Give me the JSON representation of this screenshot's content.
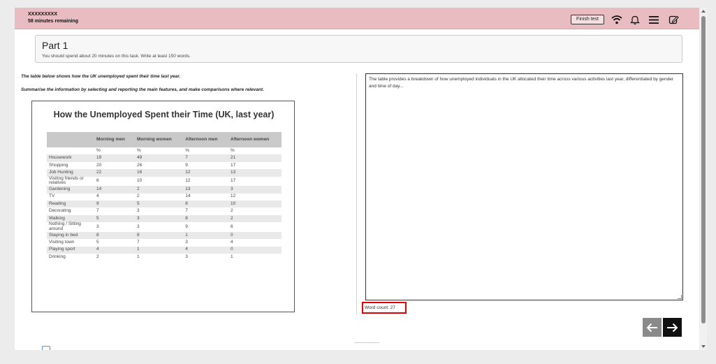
{
  "header": {
    "candidate_id": "XXXXXXXXX",
    "time_remaining": "58 minutes remaining",
    "finish_label": "Finish test",
    "icons": [
      "wifi-icon",
      "bell-icon",
      "menu-icon",
      "edit-note-icon"
    ]
  },
  "part": {
    "title": "Part 1",
    "instructions": "You should spend about 20 minutes on this task. Write at least 150 words."
  },
  "prompt": {
    "line1": "The table below shows how the UK unemployed spent their time last year.",
    "line2": "Summarise the information by selecting and reporting the main features, and make comparisons where relevant."
  },
  "figure": {
    "title": "How the Unemployed Spent their Time (UK, last year)",
    "columns": [
      "",
      "Morning men",
      "Morning women",
      "Afternoon men",
      "Afternoon women"
    ],
    "unit_row": [
      "",
      "%",
      "%",
      "%",
      "%"
    ],
    "rows": [
      [
        "Housework",
        "19",
        "49",
        "7",
        "21"
      ],
      [
        "Shopping",
        "20",
        "26",
        "9",
        "17"
      ],
      [
        "Job Hunting",
        "22",
        "16",
        "12",
        "13"
      ],
      [
        "Visiting friends or relatives",
        "6",
        "10",
        "12",
        "17"
      ],
      [
        "Gardening",
        "14",
        "2",
        "13",
        "3"
      ],
      [
        "TV",
        "4",
        "2",
        "14",
        "12"
      ],
      [
        "Reading",
        "9",
        "5",
        "8",
        "10"
      ],
      [
        "Decorating",
        "7",
        "3",
        "7",
        "2"
      ],
      [
        "Walking",
        "5",
        "3",
        "8",
        "2"
      ],
      [
        "Nothing / Sitting around",
        "3",
        "3",
        "9",
        "6"
      ],
      [
        "Staying in bed",
        "8",
        "8",
        "1",
        "0"
      ],
      [
        "Visiting town",
        "5",
        "7",
        "3",
        "4"
      ],
      [
        "Playing sport",
        "4",
        "1",
        "4",
        "0"
      ],
      [
        "Drinking",
        "2",
        "1",
        "3",
        "1"
      ]
    ]
  },
  "answer": {
    "text": "The table provides a breakdown of how unemployed individuals in the UK allocated their time across various activities last year, differentiated by gender and time of day...",
    "word_count": "Word count: 27"
  },
  "colors": {
    "header_bg": "#e8bcc1",
    "highlight_border": "#e00000",
    "table_header_bg": "#c9c9c9",
    "table_shade_bg": "#e9e9e9"
  }
}
